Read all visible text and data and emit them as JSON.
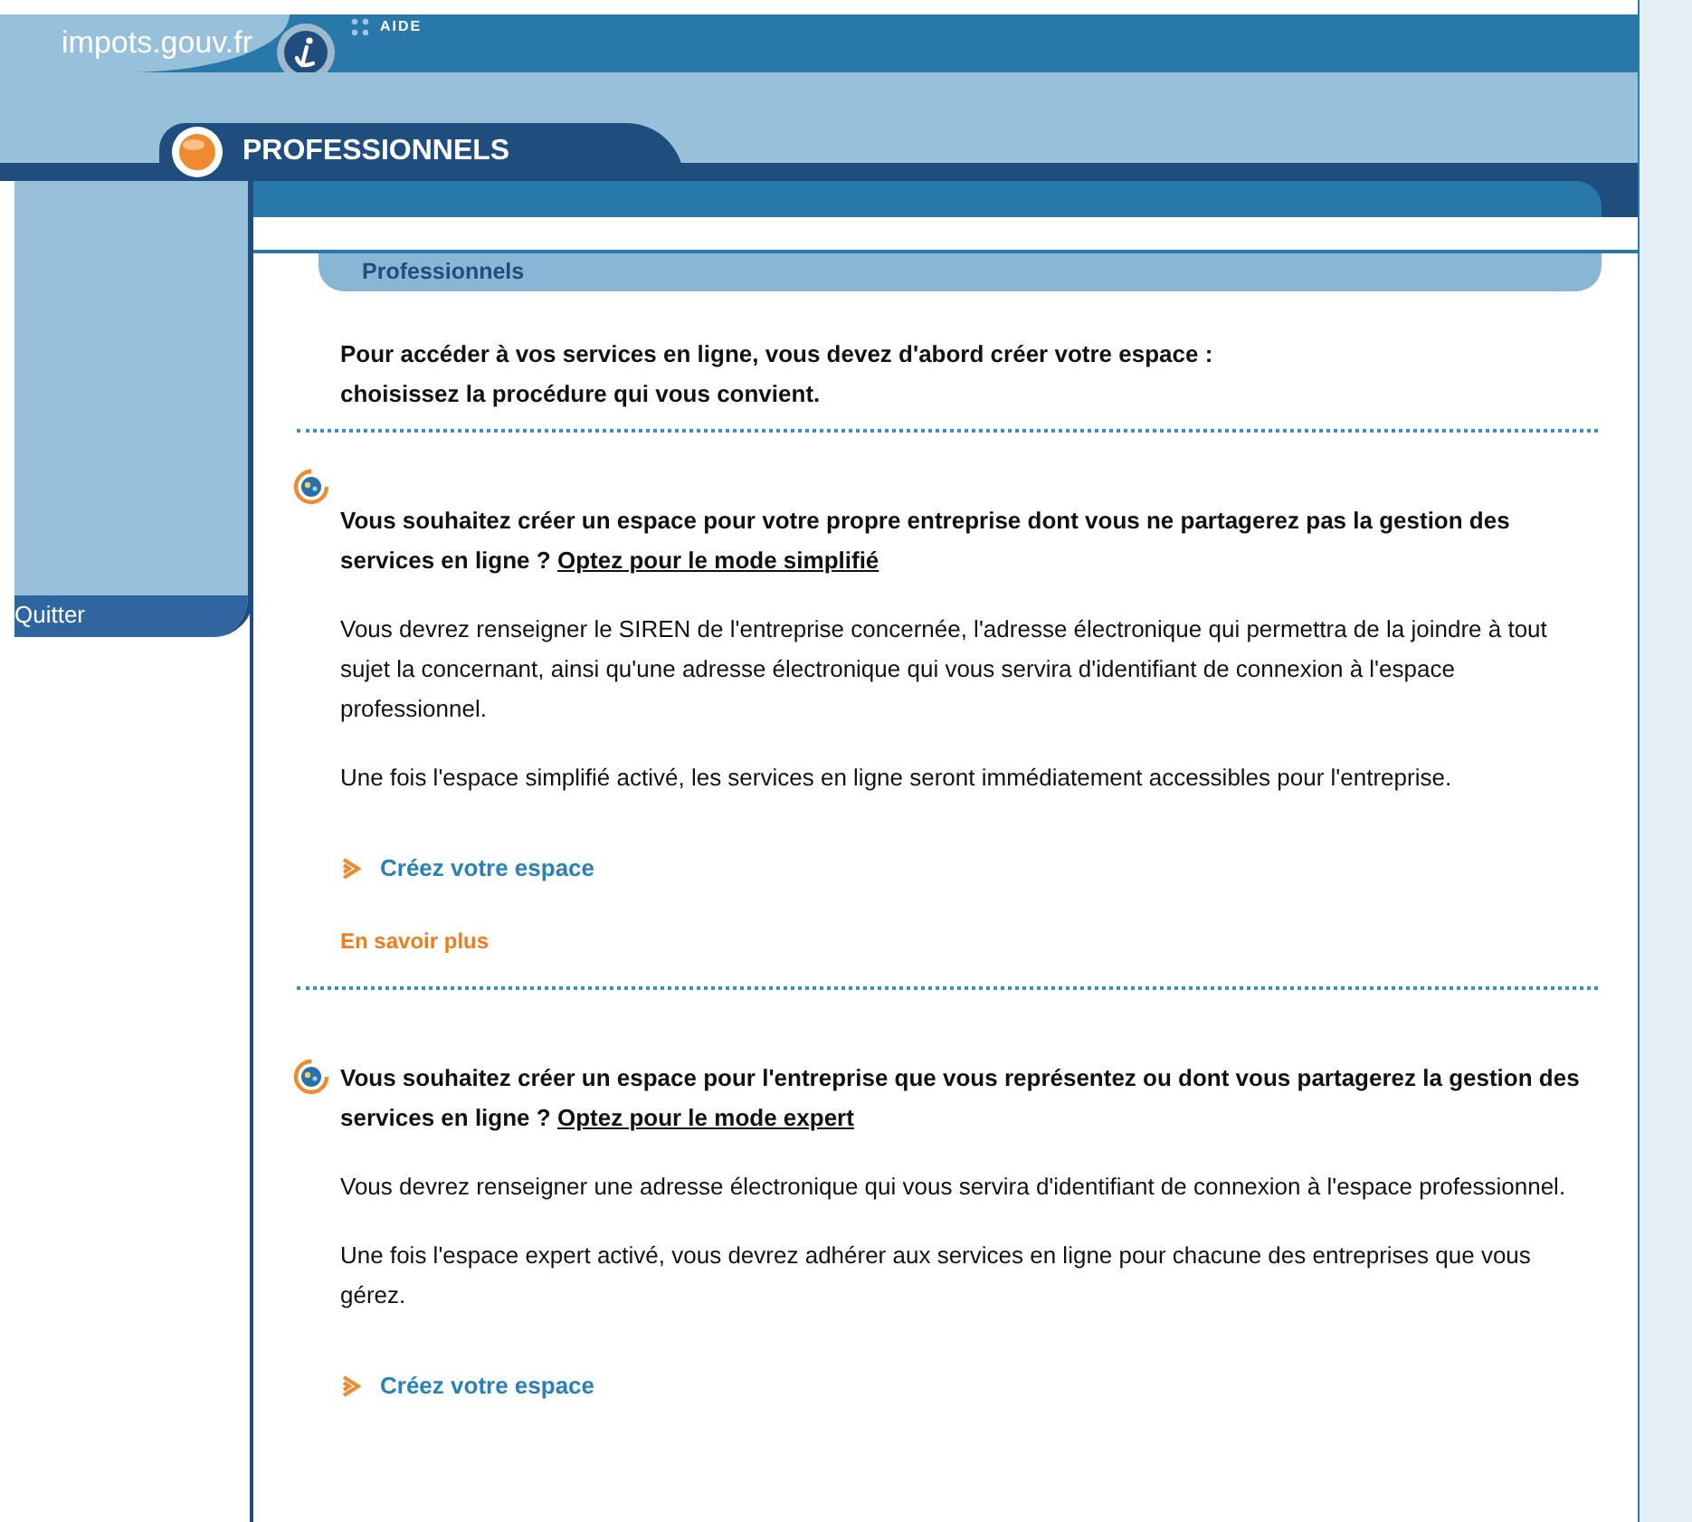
{
  "header": {
    "site_name": "impots.gouv.fr",
    "help_link": "AIDE"
  },
  "section_tab": {
    "title": "PROFESSIONNELS"
  },
  "sidebar": {
    "quit_link": "Quitter"
  },
  "breadcrumb": "Professionnels",
  "intro": [
    "Pour accéder à vos services en ligne, vous devez d'abord créer votre espace :",
    "choisissez la procédure qui vous convient."
  ],
  "options": [
    {
      "question": "Vous souhaitez créer un espace pour votre propre entreprise dont vous ne partagerez pas la gestion des services en ligne ?",
      "mode_link": "Optez pour le mode simplifié",
      "paragraphs": [
        "Vous devrez renseigner le SIREN de l'entreprise concernée, l'adresse électronique qui permettra de la joindre à tout sujet la concernant, ainsi qu'une adresse électronique qui vous servira d'identifiant de connexion à l'espace professionnel.",
        "Une fois l'espace simplifié activé, les services en ligne seront immédiatement accessibles pour l'entreprise."
      ],
      "create_link": "Créez votre espace",
      "more_link": "En savoir plus"
    },
    {
      "question": "Vous souhaitez créer un espace pour l'entreprise que vous représentez ou dont vous partagerez la gestion des services en ligne ?",
      "mode_link": "Optez pour le mode expert",
      "paragraphs": [
        "Vous devrez renseigner une adresse électronique qui vous servira d'identifiant de connexion à l'espace professionnel.",
        "Une fois l'espace expert activé, vous devrez adhérer aux services en ligne pour chacune des entreprises que vous gérez."
      ],
      "create_link": "Créez votre espace"
    }
  ]
}
